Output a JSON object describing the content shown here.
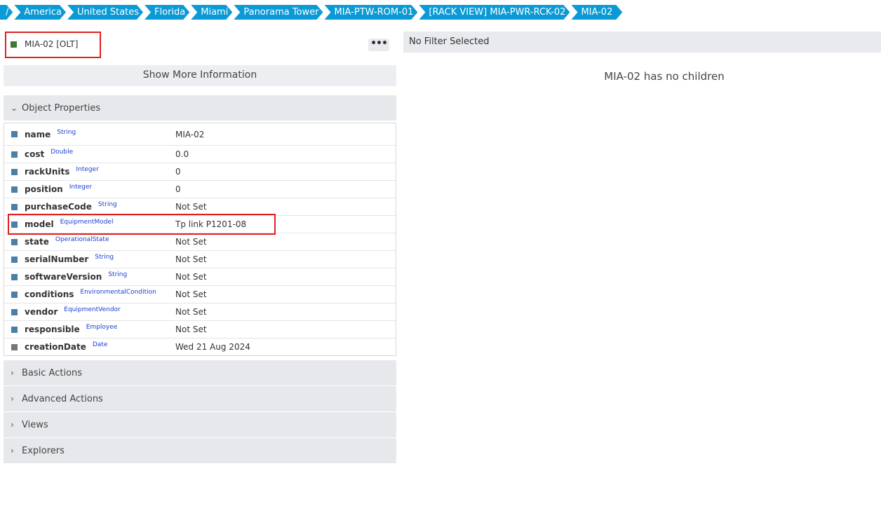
{
  "breadcrumb": [
    "/",
    "America",
    "United States",
    "Florida",
    "Miami",
    "Panorama Tower",
    "MIA-PTW-ROM-01",
    "[RACK VIEW] MIA-PWR-RCK-02",
    "MIA-02"
  ],
  "header": {
    "title": "MIA-02 [OLT]",
    "more_label": "•••",
    "status_color": "#3c7a3a"
  },
  "show_more_label": "Show More Information",
  "sections": {
    "object_properties": "Object Properties",
    "basic_actions": "Basic Actions",
    "advanced_actions": "Advanced Actions",
    "views": "Views",
    "explorers": "Explorers"
  },
  "properties": [
    {
      "name": "name",
      "type": "String",
      "value": "MIA-02"
    },
    {
      "name": "cost",
      "type": "Double",
      "value": "0.0"
    },
    {
      "name": "rackUnits",
      "type": "Integer",
      "value": "0"
    },
    {
      "name": "position",
      "type": "Integer",
      "value": "0"
    },
    {
      "name": "purchaseCode",
      "type": "String",
      "value": "Not Set"
    },
    {
      "name": "model",
      "type": "EquipmentModel",
      "value": "Tp link P1201-08"
    },
    {
      "name": "state",
      "type": "OperationalState",
      "value": "Not Set"
    },
    {
      "name": "serialNumber",
      "type": "String",
      "value": "Not Set"
    },
    {
      "name": "softwareVersion",
      "type": "String",
      "value": "Not Set"
    },
    {
      "name": "conditions",
      "type": "EnvironmentalCondition",
      "value": "Not Set"
    },
    {
      "name": "vendor",
      "type": "EquipmentVendor",
      "value": "Not Set"
    },
    {
      "name": "responsible",
      "type": "Employee",
      "value": "Not Set"
    },
    {
      "name": "creationDate",
      "type": "Date",
      "value": "Wed 21 Aug 2024"
    }
  ],
  "filter_label": "No Filter Selected",
  "no_children": "MIA-02 has no children",
  "colors": {
    "breadcrumb": "#0a9ad6",
    "highlight": "#e02020",
    "type_label": "#1a3fcf"
  }
}
